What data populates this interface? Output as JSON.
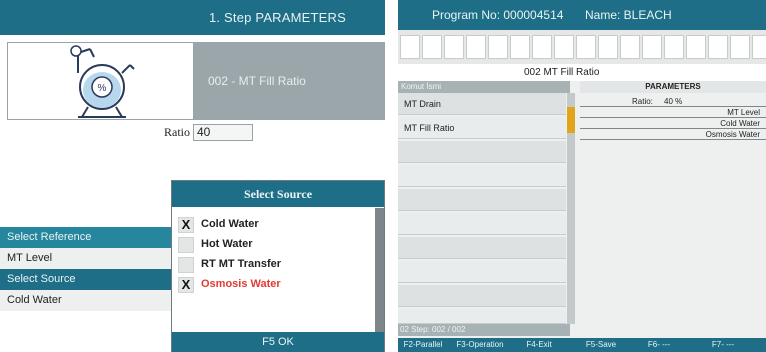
{
  "left_panel": {
    "step_title": "1. Step  PARAMETERS",
    "parameter_name": "002 -  MT Fill Ratio",
    "ratio": {
      "label": "Ratio",
      "value": "40"
    },
    "list": [
      {
        "label": "Select Reference"
      },
      {
        "label": "MT Level"
      },
      {
        "label": "Select Source"
      },
      {
        "label": "Cold Water"
      }
    ],
    "dialog": {
      "title": "Select Source",
      "options": [
        {
          "mark": "X",
          "label": "Cold Water",
          "checked": true
        },
        {
          "mark": "",
          "label": "Hot Water",
          "checked": false
        },
        {
          "mark": "",
          "label": "RT MT Transfer",
          "checked": false
        },
        {
          "mark": "X",
          "label": "Osmosis Water",
          "checked": true
        }
      ],
      "footer": "F5  OK"
    }
  },
  "right_panel": {
    "program_no": "Program No: 000004514",
    "name": "Name: BLEACH",
    "step_label": "002    MT Fill Ratio",
    "column_left": "Komut İsmi",
    "column_right": "PARAMETERS",
    "steps": [
      {
        "label": "MT Drain"
      },
      {
        "label": "MT Fill Ratio"
      },
      {
        "label": ""
      },
      {
        "label": ""
      },
      {
        "label": ""
      },
      {
        "label": ""
      },
      {
        "label": ""
      },
      {
        "label": ""
      },
      {
        "label": ""
      },
      {
        "label": ""
      }
    ],
    "parameters": [
      {
        "label": "Ratio:",
        "value": "40 %"
      },
      {
        "value": "MT Level"
      },
      {
        "value": "Cold Water"
      },
      {
        "value": "Osmosis Water"
      }
    ],
    "status": "02   Step: 002 / 002",
    "function_keys": [
      {
        "label": "F2-Parallel"
      },
      {
        "label": "F3-Operation"
      },
      {
        "label": "F4-Exit"
      },
      {
        "label": "F5-Save"
      },
      {
        "label": "F6- ---"
      },
      {
        "label": "F7- ---"
      }
    ]
  },
  "colors": {
    "header_teal": "#1d6e86",
    "highlight_teal": "#25869e",
    "param_gray": "#9aa6aa",
    "scroll_thumb": "#e2a418",
    "warning_red": "#e23a34"
  },
  "icons": {
    "machine": "dyeing-machine-icon"
  }
}
